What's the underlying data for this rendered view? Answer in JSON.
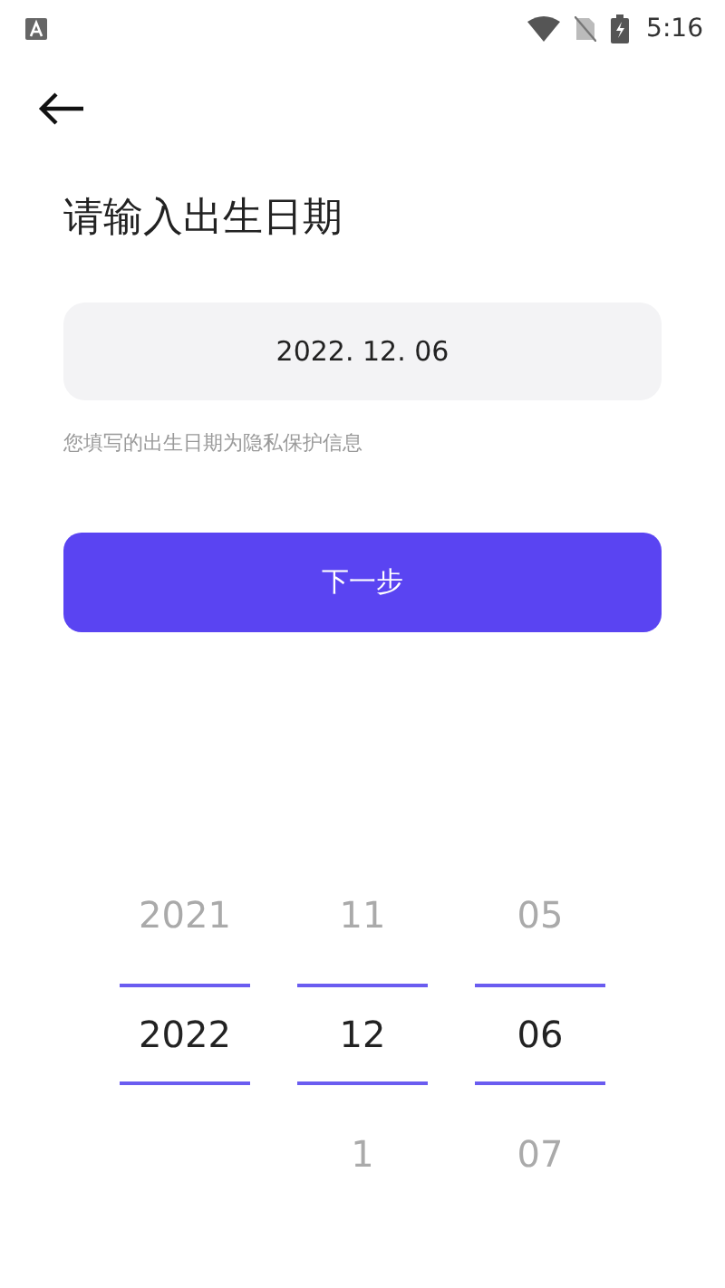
{
  "status_bar": {
    "time": "5:16"
  },
  "title": "请输入出生日期",
  "date_field": {
    "value": "2022. 12. 06"
  },
  "hint": "您填写的出生日期为隐私保护信息",
  "next_button": {
    "label": "下一步"
  },
  "picker": {
    "columns": [
      {
        "items": [
          {
            "label": "2021",
            "selected": false
          },
          {
            "label": "2022",
            "selected": true
          }
        ]
      },
      {
        "items": [
          {
            "label": "11",
            "selected": false
          },
          {
            "label": "12",
            "selected": true
          },
          {
            "label": "1",
            "selected": false
          }
        ]
      },
      {
        "items": [
          {
            "label": "05",
            "selected": false
          },
          {
            "label": "06",
            "selected": true
          },
          {
            "label": "07",
            "selected": false
          }
        ]
      }
    ]
  }
}
